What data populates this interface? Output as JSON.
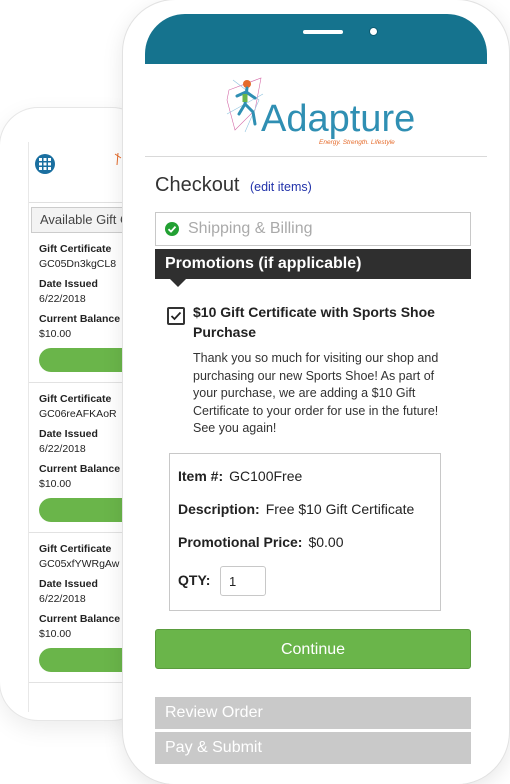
{
  "back_phone": {
    "available_label": "Available Gift C",
    "certificates": [
      {
        "type_label": "Gift Certificate",
        "code": "GC05Dn3kgCL8",
        "date_label": "Date Issued",
        "date": "6/22/2018",
        "balance_label": "Current Balance",
        "balance": "$10.00"
      },
      {
        "type_label": "Gift Certificate",
        "code": "GC06reAFKAoR",
        "date_label": "Date Issued",
        "date": "6/22/2018",
        "balance_label": "Current Balance",
        "balance": "$10.00"
      },
      {
        "type_label": "Gift Certificate",
        "code": "GC05xfYWRgAw",
        "date_label": "Date Issued",
        "date": "6/22/2018",
        "balance_label": "Current Balance",
        "balance": "$10.00"
      }
    ]
  },
  "brand": {
    "name": "Adapture",
    "tagline": "Energy. Strength. Lifestyle"
  },
  "checkout": {
    "title": "Checkout",
    "edit_link": "(edit items)",
    "shipping_step": "Shipping & Billing",
    "promotions_header": "Promotions (if applicable)",
    "promo": {
      "title": "$10 Gift Certificate with Sports Shoe Purchase",
      "checked": true,
      "description": "Thank you so much for visiting our shop and purchasing our new Sports Shoe! As part of your purchase, we are adding a $10 Gift Certificate to your order for use in the future! See you again!",
      "item_label": "Item #:",
      "item_value": "GC100Free",
      "desc_label": "Description:",
      "desc_value": "Free $10 Gift Certificate",
      "price_label": "Promotional Price:",
      "price_value": "$0.00",
      "qty_label": "QTY:",
      "qty_value": "1"
    },
    "continue_label": "Continue",
    "review_step": "Review Order",
    "pay_step": "Pay & Submit"
  },
  "colors": {
    "accent_green": "#6ab54a",
    "header_teal": "#15738e",
    "logo_blue": "#2f8fb3",
    "dark_bar": "#2f2f2f"
  }
}
